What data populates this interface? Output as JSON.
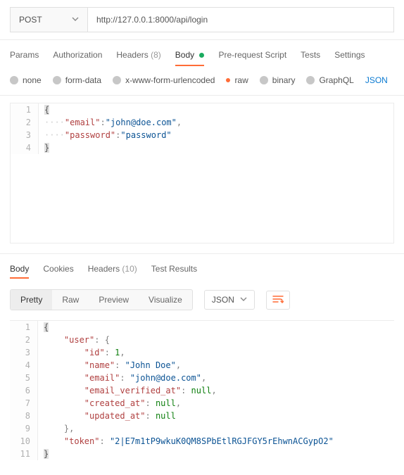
{
  "request": {
    "method": "POST",
    "url": "http://127.0.0.1:8000/api/login"
  },
  "tabs": {
    "params": "Params",
    "authorization": "Authorization",
    "headers_label": "Headers",
    "headers_count": "(8)",
    "body": "Body",
    "prerequest": "Pre-request Script",
    "tests": "Tests",
    "settings": "Settings"
  },
  "body_types": {
    "none": "none",
    "formdata": "form-data",
    "urlencoded": "x-www-form-urlencoded",
    "raw": "raw",
    "binary": "binary",
    "graphql": "GraphQL",
    "json": "JSON"
  },
  "request_body": {
    "email_key": "\"email\"",
    "email_val": "\"john@doe.com\"",
    "password_key": "\"password\"",
    "password_val": "\"password\""
  },
  "resp_tabs": {
    "body": "Body",
    "cookies": "Cookies",
    "headers_label": "Headers",
    "headers_count": "(10)",
    "test_results": "Test Results"
  },
  "resp_views": {
    "pretty": "Pretty",
    "raw": "Raw",
    "preview": "Preview",
    "visualize": "Visualize",
    "lang": "JSON"
  },
  "response_body": {
    "user_key": "\"user\"",
    "id_key": "\"id\"",
    "id_val": "1",
    "name_key": "\"name\"",
    "name_val": "\"John Doe\"",
    "email_key": "\"email\"",
    "email_val": "\"john@doe.com\"",
    "ev_key": "\"email_verified_at\"",
    "null_val": "null",
    "created_key": "\"created_at\"",
    "updated_key": "\"updated_at\"",
    "token_key": "\"token\"",
    "token_val": "\"2|E7m1tP9wkuK0QM8SPbEtlRGJFGY5rEhwnACGypO2\""
  },
  "linenums": {
    "l1": "1",
    "l2": "2",
    "l3": "3",
    "l4": "4",
    "l5": "5",
    "l6": "6",
    "l7": "7",
    "l8": "8",
    "l9": "9",
    "l10": "10",
    "l11": "11"
  }
}
